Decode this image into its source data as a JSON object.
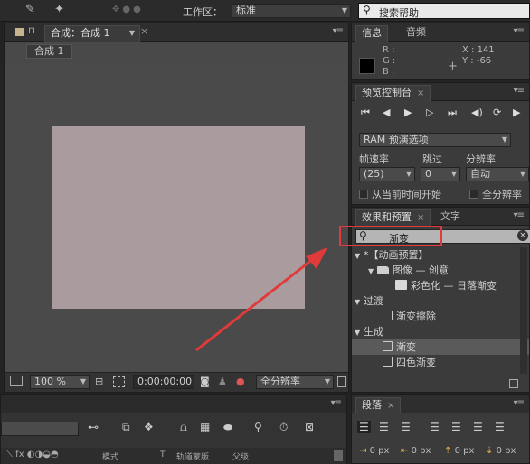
{
  "topbar": {
    "workspace_label": "工作区：",
    "workspace_value": "标准",
    "search_placeholder": "搜索帮助"
  },
  "comp_panel": {
    "tab_label": "合成：合成 1",
    "subtab_label": "合成 1",
    "zoom": "100 %",
    "timecode": "0:00:00:00",
    "resolution": "全分辨率"
  },
  "info_panel": {
    "tabs": [
      "信息",
      "音频"
    ],
    "r_label": "R :",
    "g_label": "G :",
    "b_label": "B :",
    "x_readout": "X : 141",
    "y_readout": "Y : -66"
  },
  "preview_panel": {
    "tab_label": "预览控制台",
    "ram_options": "RAM 预演选项",
    "framerate_label": "帧速率",
    "skip_label": "跳过",
    "resolution_label": "分辨率",
    "framerate_value": "(25)",
    "skip_value": "0",
    "resolution_value": "自动",
    "from_current_label": "从当前时间开始",
    "fullres_label": "全分辨率"
  },
  "effects_panel": {
    "tabs": [
      "效果和预置",
      "文字"
    ],
    "search_value": "渐变",
    "tree": [
      {
        "label": "*【动画预置】",
        "level": 0,
        "kind": "category"
      },
      {
        "label": "图像 — 创意",
        "level": 1,
        "kind": "folder"
      },
      {
        "label": "彩色化 — 日落渐变",
        "level": 2,
        "kind": "preset"
      },
      {
        "label": "过渡",
        "level": 0,
        "kind": "category"
      },
      {
        "label": "渐变擦除",
        "level": 1,
        "kind": "effect"
      },
      {
        "label": "生成",
        "level": 0,
        "kind": "category"
      },
      {
        "label": "渐变",
        "level": 1,
        "kind": "effect",
        "selected": true
      },
      {
        "label": "四色渐变",
        "level": 1,
        "kind": "effect"
      }
    ]
  },
  "timeline": {
    "mode_label": "模式",
    "t_label": "T",
    "trackmatte_label": "轨道蒙版",
    "parent_label": "父级"
  },
  "paragraph_panel": {
    "tab_label": "段落",
    "indent_values": [
      "0 px",
      "0 px",
      "0 px",
      "0 px"
    ]
  },
  "colors": {
    "comp_solid": "#aa9c9e",
    "arrow": "#e03a3a",
    "highlight_box": "#e03a3a"
  }
}
